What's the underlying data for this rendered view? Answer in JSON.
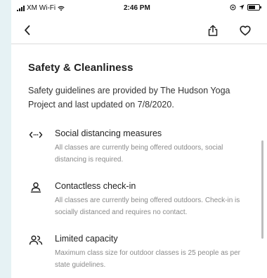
{
  "status_bar": {
    "carrier": "XM Wi-Fi",
    "time": "2:46 PM"
  },
  "nav": {
    "back_icon": "chevron-left-icon",
    "share_icon": "share-icon",
    "favorite_icon": "heart-icon"
  },
  "section": {
    "title": "Safety & Cleanliness",
    "intro": "Safety guidelines are provided by The Hudson Yoga Project and last updated on 7/8/2020.",
    "items": [
      {
        "icon": "social-distancing-icon",
        "title": "Social distancing measures",
        "description": "All classes are currently being offered outdoors, social distancing is required."
      },
      {
        "icon": "person-checkin-icon",
        "title": "Contactless check-in",
        "description": "All classes are currently being offered outdoors. Check-in is socially distanced and requires no contact."
      },
      {
        "icon": "group-capacity-icon",
        "title": "Limited capacity",
        "description": "Maximum class size for outdoor classes is 25 people as per state guidelines."
      }
    ]
  }
}
